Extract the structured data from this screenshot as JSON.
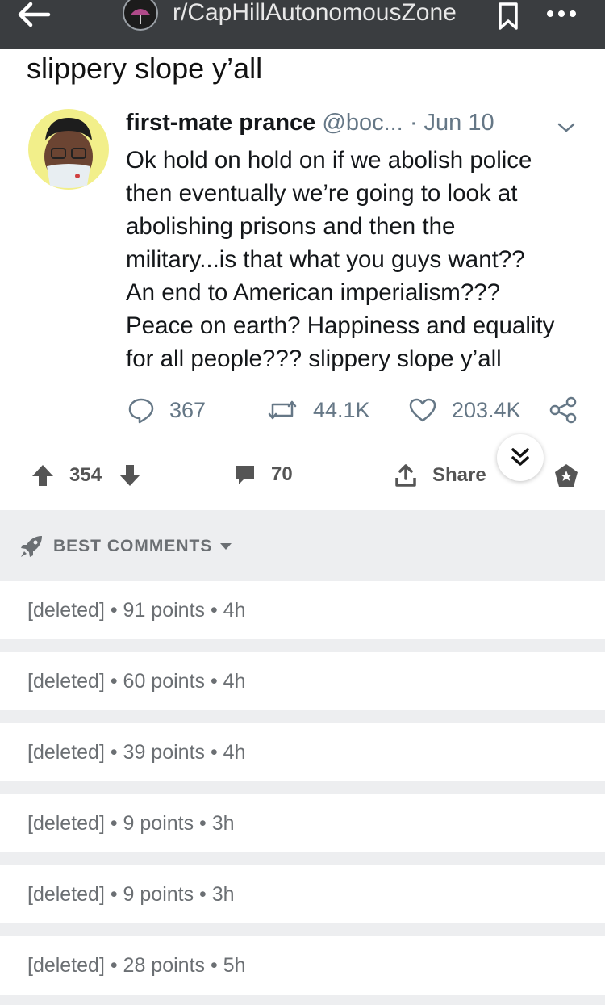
{
  "header": {
    "subreddit": "r/CapHillAutonomousZone",
    "back_icon": "back-arrow-icon",
    "bookmark_icon": "bookmark-icon",
    "more_icon": "more-icon"
  },
  "post": {
    "title": "slippery slope y’all",
    "tweet": {
      "name": "first-mate prance",
      "handle": "@boc...",
      "separator": "·",
      "date": "Jun 10",
      "lines": [
        "Ok hold on hold on if we abolish police",
        "then eventually we’re going to look at",
        "abolishing prisons and then the",
        "military...is that what you guys want??",
        "An end to American imperialism???",
        "Peace on earth? Happiness and equality",
        "for all people??? slippery slope y’all"
      ],
      "replies": "367",
      "retweets": "44.1K",
      "likes": "203.4K"
    },
    "votes": "354",
    "comments_count": "70",
    "share_label": "Share"
  },
  "comments_section": {
    "sort_label": "BEST COMMENTS",
    "items": [
      {
        "meta": "[deleted] • 91 points • 4h"
      },
      {
        "meta": "[deleted] • 60 points • 4h"
      },
      {
        "meta": "[deleted] • 39 points • 4h"
      },
      {
        "meta": "[deleted] • 9 points • 3h"
      },
      {
        "meta": "[deleted] • 9 points • 3h"
      },
      {
        "meta": "[deleted] • 28 points • 5h"
      }
    ]
  },
  "colors": {
    "topbar": "#3a3d40",
    "section_bg": "#edeef0",
    "tweet_secondary": "#657786"
  }
}
